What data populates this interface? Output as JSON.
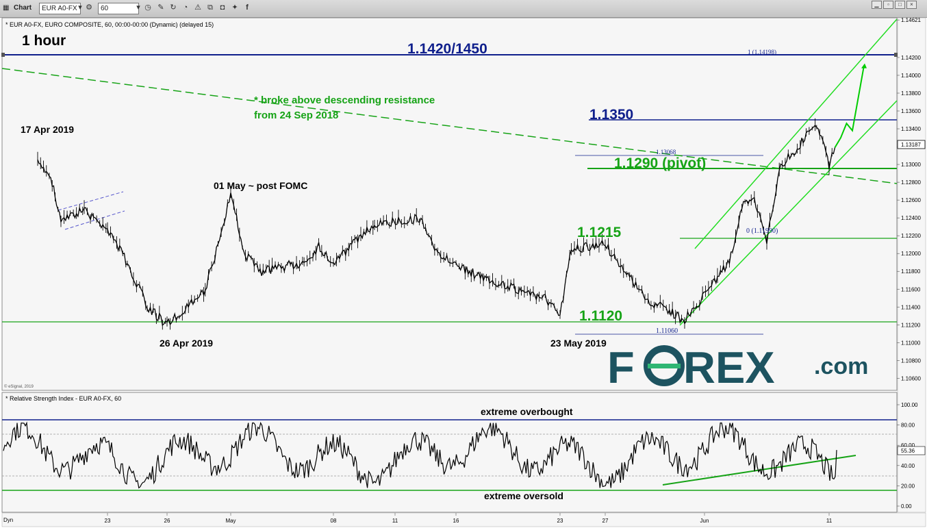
{
  "toolbar": {
    "chart_tab": "Chart",
    "symbol": "EUR A0-FX",
    "interval": "60"
  },
  "price_panel": {
    "header": "* EUR A0-FX, EURO COMPOSITE, 60, 00:00-00:00 (Dynamic) (delayed 15)",
    "timeframe": "1 hour",
    "copyright": "© eSignal, 2019",
    "current_price": "1.13187",
    "y_ticks": [
      "1.14621",
      "1.14200",
      "1.14000",
      "1.13800",
      "1.13600",
      "1.13400",
      "1.13200",
      "1.13000",
      "1.12800",
      "1.12600",
      "1.12400",
      "1.12200",
      "1.12000",
      "1.11800",
      "1.11600",
      "1.11400",
      "1.11200",
      "1.11000",
      "1.10800",
      "1.10600"
    ]
  },
  "annotations": {
    "target": "1.1420/1450",
    "fib_top": "1 (1.14198)",
    "resistance_note_1": "* broke above descending resistance",
    "resistance_note_2": "from 24 Sep 2018",
    "level_1350": "1.1350",
    "fib_high": "1.13068",
    "pivot": "1.1290 (pivot)",
    "level_1215": "1.1215",
    "fib_zero": "0 (1.11990)",
    "level_1120": "1.1120",
    "fib_low": "1.11060",
    "apr17": "17 Apr 2019",
    "may01": "01 May ~ post FOMC",
    "apr26": "26 Apr 2019",
    "may23": "23 May 2019"
  },
  "logo": {
    "text_left": "F",
    "text_o": "O",
    "text_right": "REX",
    "text_com": ".com"
  },
  "rsi_panel": {
    "header": "* Relative Strength Index - EUR A0-FX, 60",
    "current": "55.36",
    "y_ticks": [
      "100.00",
      "80.00",
      "60.00",
      "40.00",
      "20.00",
      "0.00"
    ],
    "overbought": "extreme overbought",
    "oversold": "extreme oversold"
  },
  "x_axis": {
    "corner": "Dyn",
    "labels": [
      "23",
      "26",
      "May",
      "08",
      "11",
      "16",
      "23",
      "27",
      "Jun",
      "11"
    ]
  },
  "colors": {
    "navy": "#0f1f8c",
    "green_text": "#16a316",
    "green_line": "#00cc00",
    "logo": "#1d5360",
    "logo_accent": "#2fb673"
  },
  "chart_data": {
    "type": "candlestick",
    "timeframe": "1 hour",
    "ylim": [
      1.1048,
      1.1463
    ],
    "horizontal_levels": [
      1.142,
      1.135,
      1.129,
      1.1215,
      1.112
    ],
    "fib_levels": [
      1.14198,
      1.13068,
      1.1199,
      1.1106
    ],
    "price_path": [
      [
        "17 Apr",
        1.13
      ],
      [
        "18 Apr",
        1.129
      ],
      [
        "19 Apr",
        1.124
      ],
      [
        "21 Apr",
        1.1248
      ],
      [
        "23 Apr",
        1.1228
      ],
      [
        "24 Apr",
        1.119
      ],
      [
        "25 Apr",
        1.114
      ],
      [
        "26 Apr",
        1.112
      ],
      [
        "29 Apr",
        1.116
      ],
      [
        "30 Apr",
        1.121
      ],
      [
        "01 May",
        1.1265
      ],
      [
        "02 May",
        1.1198
      ],
      [
        "03 May",
        1.118
      ],
      [
        "06 May",
        1.119
      ],
      [
        "07 May",
        1.1208
      ],
      [
        "08 May",
        1.119
      ],
      [
        "10 May",
        1.1232
      ],
      [
        "13 May",
        1.124
      ],
      [
        "14 May",
        1.121
      ],
      [
        "16 May",
        1.1185
      ],
      [
        "20 May",
        1.116
      ],
      [
        "22 May",
        1.115
      ],
      [
        "23 May",
        1.113
      ],
      [
        "24 May",
        1.1205
      ],
      [
        "27 May",
        1.121
      ],
      [
        "29 May",
        1.115
      ],
      [
        "31 May",
        1.1125
      ],
      [
        "03 Jun",
        1.119
      ],
      [
        "04 Jun",
        1.1252
      ],
      [
        "05 Jun",
        1.126
      ],
      [
        "06 Jun",
        1.1215
      ],
      [
        "07 Jun",
        1.1295
      ],
      [
        "10 Jun",
        1.1345
      ],
      [
        "11 Jun",
        1.13
      ],
      [
        "12 Jun",
        1.1319
      ]
    ],
    "projection": [
      [
        "12 Jun",
        1.1319
      ],
      [
        "13 Jun",
        1.133
      ],
      [
        "14 Jun",
        1.1346
      ],
      [
        "15 Jun",
        1.1338
      ],
      [
        "17 Jun",
        1.1411
      ]
    ],
    "rsi": {
      "ylim": [
        0,
        100
      ],
      "levels": [
        80,
        30
      ],
      "extreme_levels": [
        85,
        15
      ],
      "current": 55.36
    }
  }
}
